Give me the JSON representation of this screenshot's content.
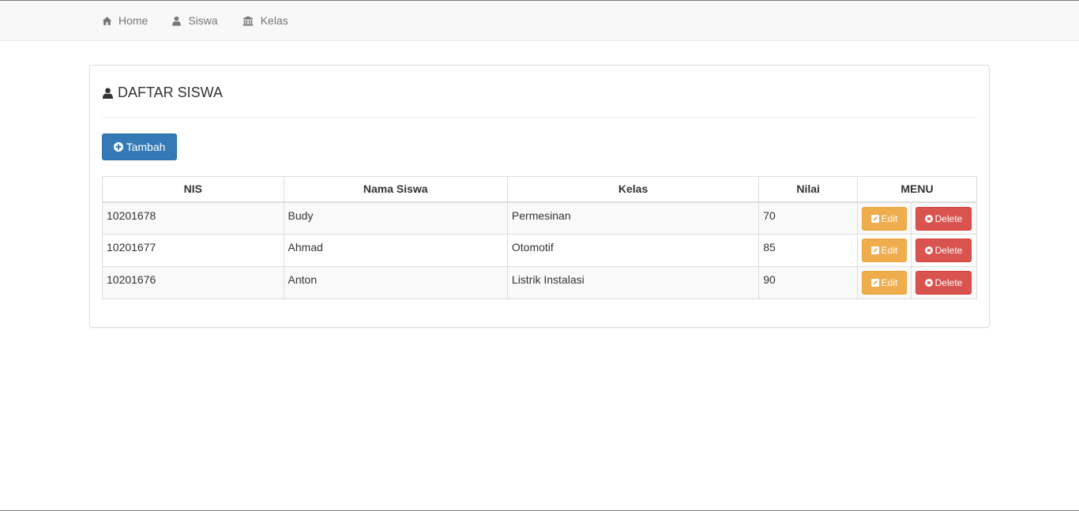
{
  "nav": {
    "items": [
      {
        "label": "Home",
        "icon": "home-icon"
      },
      {
        "label": "Siswa",
        "icon": "user-icon"
      },
      {
        "label": "Kelas",
        "icon": "institution-icon"
      }
    ]
  },
  "panel": {
    "title": "DAFTAR SISWA",
    "add_label": "Tambah"
  },
  "table": {
    "headers": [
      "NIS",
      "Nama Siswa",
      "Kelas",
      "Nilai",
      "MENU"
    ],
    "rows": [
      {
        "nis": "10201678",
        "nama": "Budy",
        "kelas": "Permesinan",
        "nilai": "70"
      },
      {
        "nis": "10201677",
        "nama": "Ahmad",
        "kelas": "Otomotif",
        "nilai": "85"
      },
      {
        "nis": "10201676",
        "nama": "Anton",
        "kelas": "Listrik Instalasi",
        "nilai": "90"
      }
    ],
    "edit_label": "Edit",
    "delete_label": "Delete"
  },
  "colors": {
    "primary": "#337ab7",
    "warning": "#f0ad4e",
    "danger": "#d9534f",
    "navbar_bg": "#f8f8f8"
  }
}
